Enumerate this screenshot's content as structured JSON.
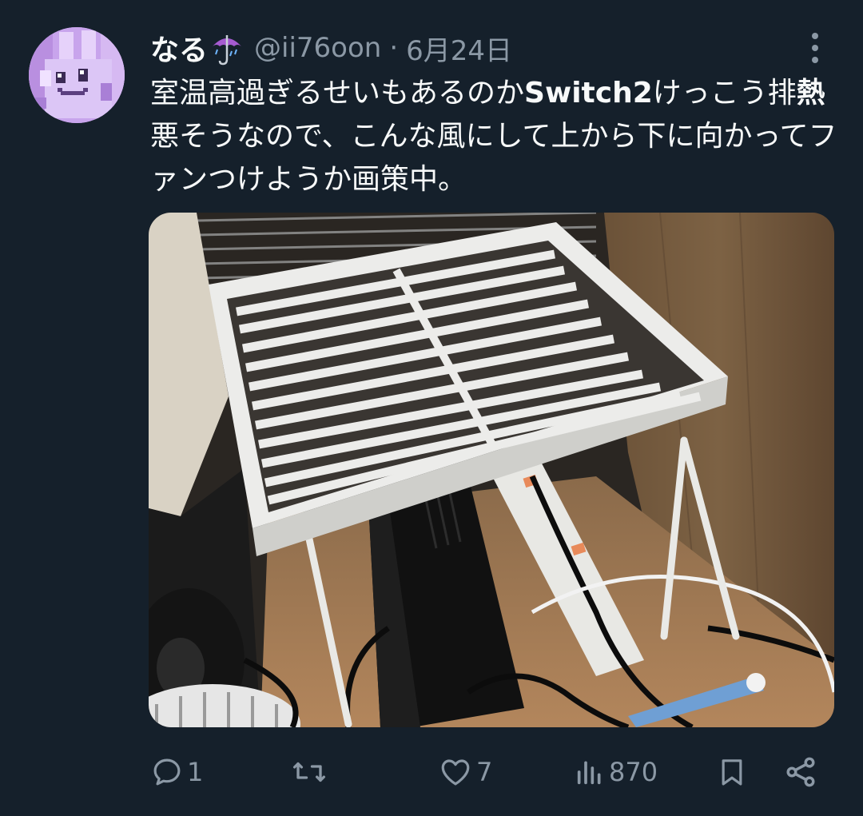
{
  "tweet": {
    "display_name": "なる",
    "name_emoji_icon": "umbrella-with-rain-icon",
    "handle": "@ii76oon",
    "separator": "·",
    "date": "6月24日",
    "text_segments": [
      "室温高過ぎるせいもあるのか",
      "Switch2",
      "けっこう排",
      "熱",
      "悪そうなので、こんな風にして上から下に向かってファンつけようか画策中。"
    ],
    "media_description_icon": "photo-shelf-over-switch2-dock",
    "actions": {
      "reply_count": "1",
      "retweet_count": "",
      "like_count": "7",
      "views_count": "870"
    }
  },
  "colors": {
    "background": "#15202b",
    "text_primary": "#f7f9f9",
    "text_secondary": "#8b98a5"
  }
}
